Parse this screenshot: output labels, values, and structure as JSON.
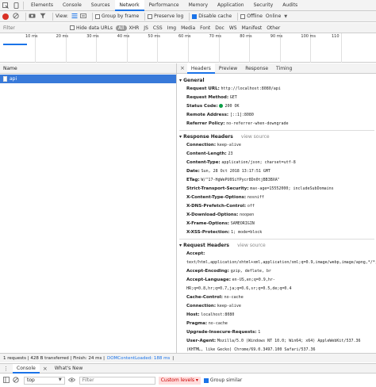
{
  "tabs": [
    "Elements",
    "Console",
    "Sources",
    "Network",
    "Performance",
    "Memory",
    "Application",
    "Security",
    "Audits"
  ],
  "active_tab": "Network",
  "toolbar": {
    "view_label": "View:",
    "group_by_frame": "Group by frame",
    "preserve_log": "Preserve log",
    "disable_cache": "Disable cache",
    "offline": "Offline",
    "throttle": "Online"
  },
  "filter": {
    "placeholder": "Filter",
    "hide_data_urls": "Hide data URLs",
    "types": [
      "All",
      "XHR",
      "JS",
      "CSS",
      "Img",
      "Media",
      "Font",
      "Doc",
      "WS",
      "Manifest",
      "Other"
    ]
  },
  "timeline_ticks": [
    "10 ms",
    "20 ms",
    "30 ms",
    "40 ms",
    "50 ms",
    "60 ms",
    "70 ms",
    "80 ms",
    "90 ms",
    "100 ms",
    "110"
  ],
  "list": {
    "header": "Name",
    "rows": [
      "api"
    ]
  },
  "detail_tabs": [
    "Headers",
    "Preview",
    "Response",
    "Timing"
  ],
  "active_detail_tab": "Headers",
  "general": {
    "title": "General",
    "items": [
      {
        "k": "Request URL:",
        "v": "http://localhost:8080/api"
      },
      {
        "k": "Request Method:",
        "v": "GET"
      },
      {
        "k": "Status Code:",
        "v": "200 OK"
      },
      {
        "k": "Remote Address:",
        "v": "[::1]:8080"
      },
      {
        "k": "Referrer Policy:",
        "v": "no-referrer-when-downgrade"
      }
    ]
  },
  "response_headers": {
    "title": "Response Headers",
    "view_source": "view source",
    "items": [
      {
        "k": "Connection:",
        "v": "keep-alive"
      },
      {
        "k": "Content-Length:",
        "v": "23"
      },
      {
        "k": "Content-Type:",
        "v": "application/json; charset=utf-8"
      },
      {
        "k": "Date:",
        "v": "Sun, 28 Oct 2018 13:17:51 GMT"
      },
      {
        "k": "ETag:",
        "v": "W/\"17-HgWePU0SiYPycr8Dn0tjBB3BXA\""
      },
      {
        "k": "Strict-Transport-Security:",
        "v": "max-age=15552000; includeSubDomains"
      },
      {
        "k": "X-Content-Type-Options:",
        "v": "nosniff"
      },
      {
        "k": "X-DNS-Prefetch-Control:",
        "v": "off"
      },
      {
        "k": "X-Download-Options:",
        "v": "noopen"
      },
      {
        "k": "X-Frame-Options:",
        "v": "SAMEORIGIN"
      },
      {
        "k": "X-XSS-Protection:",
        "v": "1; mode=block"
      }
    ]
  },
  "request_headers": {
    "title": "Request Headers",
    "view_source": "view source",
    "items": [
      {
        "k": "Accept:",
        "v": "text/html,application/xhtml+xml,application/xml;q=0.9,image/webp,image/apng,*/*;q=0.8"
      },
      {
        "k": "Accept-Encoding:",
        "v": "gzip, deflate, br"
      },
      {
        "k": "Accept-Language:",
        "v": "en-US,en;q=0.9,hr-HR;q=0.8,hr;q=0.7,ja;q=0.6,sr;q=0.5,de;q=0.4"
      },
      {
        "k": "Cache-Control:",
        "v": "no-cache"
      },
      {
        "k": "Connection:",
        "v": "keep-alive"
      },
      {
        "k": "Host:",
        "v": "localhost:8080"
      },
      {
        "k": "Pragma:",
        "v": "no-cache"
      },
      {
        "k": "Upgrade-Insecure-Requests:",
        "v": "1"
      },
      {
        "k": "User-Agent:",
        "v": "Mozilla/5.0 (Windows NT 10.0; Win64; x64) AppleWebKit/537.36 (KHTML, like Gecko) Chrome/69.0.3497.100 Safari/537.36"
      }
    ]
  },
  "status_bar": {
    "summary": "1 requests | 428 B transferred | Finish: 24 ms |",
    "dom_loaded": "DOMContentLoaded: 188 ms",
    "load": "|"
  },
  "drawer": {
    "tabs": [
      "Console",
      "What's New"
    ],
    "context": "top",
    "filter_placeholder": "Filter",
    "levels": "Custom levels",
    "group_similar": "Group similar"
  },
  "colors": {
    "accent": "#1a73e8",
    "selected_row": "#3879d9",
    "status_ok": "#0a9e45",
    "record": "#d93025"
  }
}
